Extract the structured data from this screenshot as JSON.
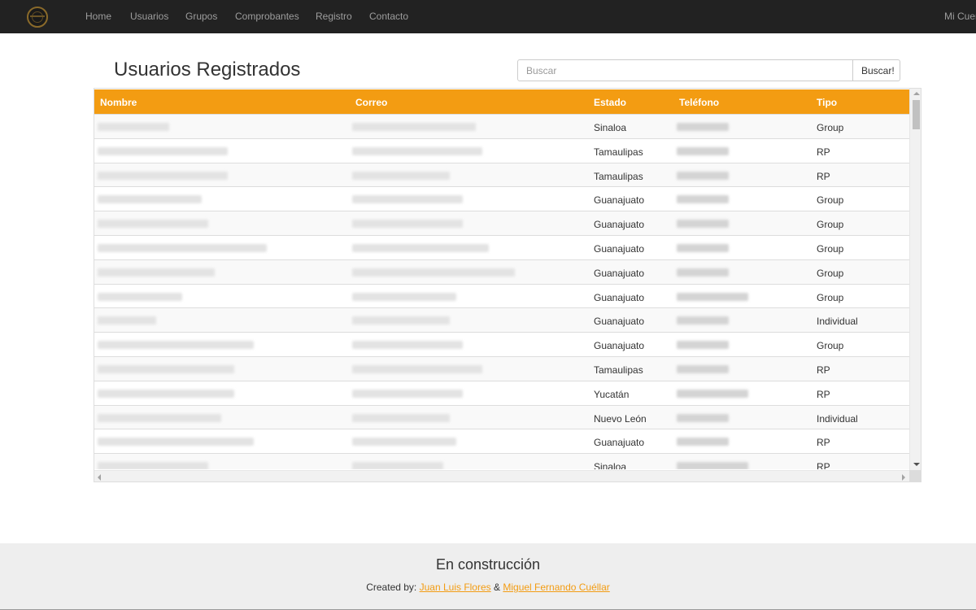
{
  "navbar": {
    "items": [
      {
        "label": "Home"
      },
      {
        "label": "Usuarios"
      },
      {
        "label": "Grupos"
      },
      {
        "label": "Comprobantes"
      },
      {
        "label": "Registro"
      },
      {
        "label": "Contacto"
      }
    ],
    "account_label": "Mi Cuenta"
  },
  "page": {
    "title": "Usuarios Registrados"
  },
  "search": {
    "placeholder": "Buscar",
    "button_label": "Buscar!"
  },
  "table": {
    "columns": [
      "Nombre",
      "Correo",
      "Estado",
      "Teléfono",
      "Tipo"
    ],
    "rows": [
      {
        "estado": "Sinaloa",
        "tipo": "Group"
      },
      {
        "estado": "Tamaulipas",
        "tipo": "RP"
      },
      {
        "estado": "Tamaulipas",
        "tipo": "RP"
      },
      {
        "estado": "Guanajuato",
        "tipo": "Group"
      },
      {
        "estado": "Guanajuato",
        "tipo": "Group"
      },
      {
        "estado": "Guanajuato",
        "tipo": "Group"
      },
      {
        "estado": "Guanajuato",
        "tipo": "Group"
      },
      {
        "estado": "Guanajuato",
        "tipo": "Group"
      },
      {
        "estado": "Guanajuato",
        "tipo": "Individual"
      },
      {
        "estado": "Guanajuato",
        "tipo": "Group"
      },
      {
        "estado": "Tamaulipas",
        "tipo": "RP"
      },
      {
        "estado": "Yucatán",
        "tipo": "RP"
      },
      {
        "estado": "Nuevo León",
        "tipo": "Individual"
      },
      {
        "estado": "Guanajuato",
        "tipo": "RP"
      },
      {
        "estado": "Sinaloa",
        "tipo": "RP"
      }
    ]
  },
  "footer": {
    "title": "En construcción",
    "created_by": "Created by:",
    "author1": "Juan Luis Flores",
    "separator": "&",
    "author2": "Miguel Fernando Cuéllar"
  },
  "colors": {
    "navbar": "#222222",
    "accent": "#f39c12",
    "footer_bg": "#eeeeee"
  }
}
